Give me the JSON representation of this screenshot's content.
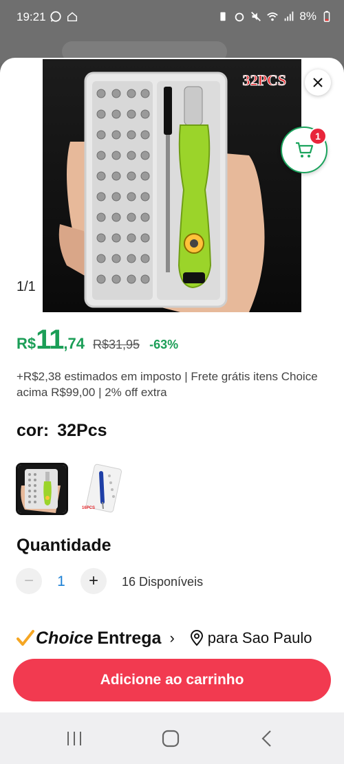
{
  "status_bar": {
    "time": "19:21",
    "battery": "8%",
    "icons": [
      "whatsapp-icon",
      "home-icon",
      "battery-saver-icon",
      "alarm-icon",
      "mute-icon",
      "wifi-icon",
      "signal-icon",
      "battery-icon"
    ]
  },
  "product": {
    "image_label": "32PCS",
    "image_counter": "1/1",
    "cart_badge": "1"
  },
  "price": {
    "currency": "R$",
    "integer": "11",
    "decimal": ",74",
    "original": "R$31,95",
    "discount": "-63%",
    "tax_note": "+R$2,38 estimados em imposto | Frete grátis itens Choice acima R$99,00 | 2% off extra"
  },
  "variant": {
    "label": "cor:",
    "value": "32Pcs",
    "option2_tag": "16PCS"
  },
  "quantity": {
    "title": "Quantidade",
    "minus": "−",
    "value": "1",
    "plus": "+",
    "available": "16 Disponíveis"
  },
  "delivery": {
    "brand": "Choice",
    "label": "Entrega",
    "chevron": "›",
    "location": "para Sao Paulo"
  },
  "actions": {
    "add_to_cart": "Adicione ao carrinho"
  },
  "colors": {
    "price_green": "#1b9e57",
    "accent_red": "#f23a50",
    "choice_orange": "#f5a623",
    "qty_blue": "#1a7fd4"
  }
}
